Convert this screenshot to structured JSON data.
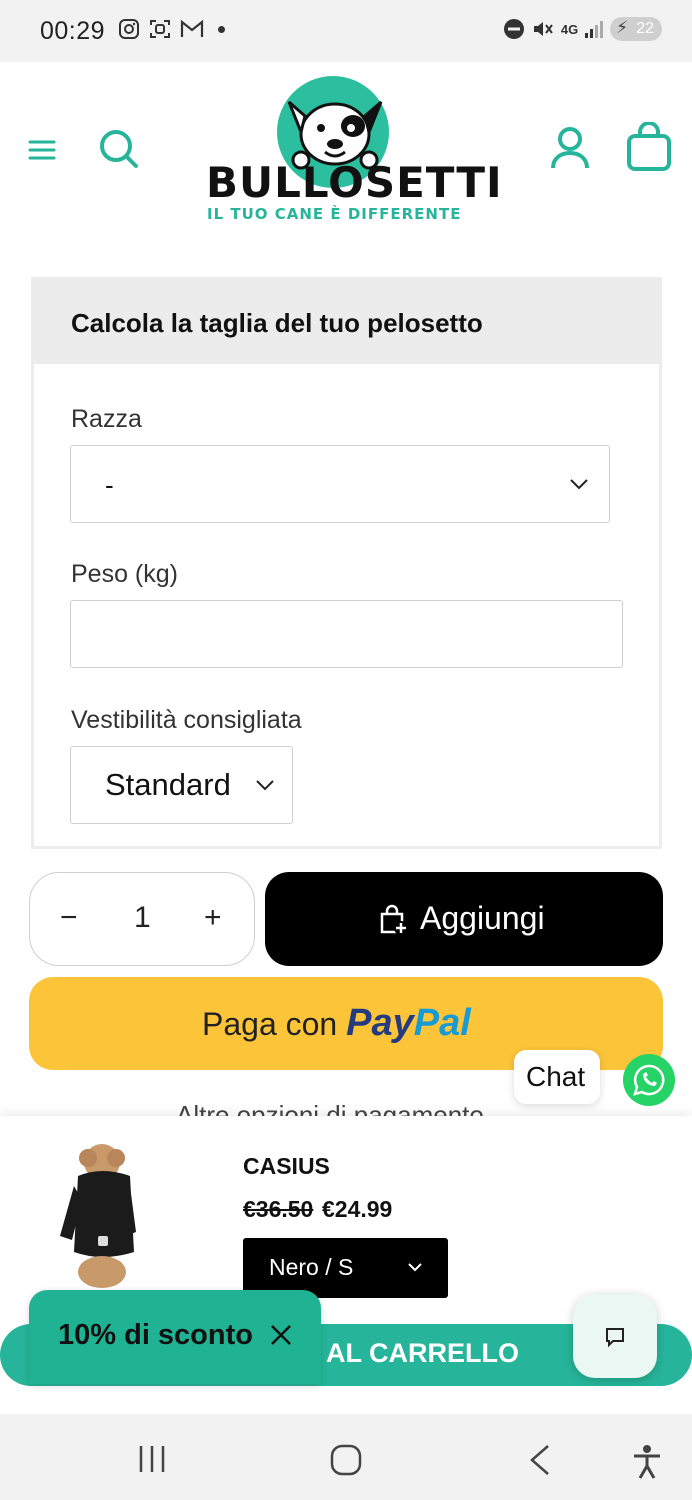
{
  "status_bar": {
    "time": "00:29",
    "network": "4G",
    "battery": "22"
  },
  "header": {
    "brand": "BULLOSETTI",
    "tagline": "IL TUO CANE È DIFFERENTE"
  },
  "size_calculator": {
    "title": "Calcola la taglia del tuo pelosetto",
    "breed_label": "Razza",
    "breed_value": "-",
    "weight_label": "Peso (kg)",
    "weight_value": "",
    "fit_label": "Vestibilità consigliata",
    "fit_value": "Standard"
  },
  "purchase": {
    "quantity": "1",
    "minus": "−",
    "plus": "+",
    "add_label": "Aggiungi",
    "paypal_prefix": "Paga con",
    "paypal_brand_1": "Pay",
    "paypal_brand_2": "Pal",
    "more_options": "Altre opzioni di pagamento"
  },
  "chat": {
    "label": "Chat"
  },
  "sticky_bar": {
    "product_name": "CASIUS",
    "old_price": "€36.50",
    "new_price": "€24.99",
    "variant": "Nero / S",
    "cart_button": "AL CARRELLO",
    "discount": "10% di sconto"
  },
  "colors": {
    "accent": "#26b59a",
    "paypal_yellow": "#fcc439",
    "paypal_dark": "#253b80",
    "paypal_light": "#179bd7"
  }
}
